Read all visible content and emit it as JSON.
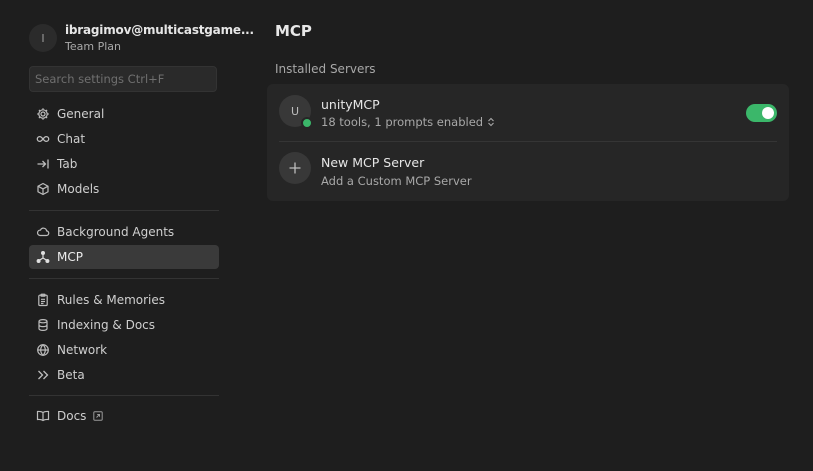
{
  "account": {
    "avatar_initial": "I",
    "email": "ibragimov@multicastgame...",
    "plan": "Team Plan"
  },
  "search": {
    "placeholder": "Search settings Ctrl+F"
  },
  "sidebar": {
    "groups": [
      [
        {
          "label": "General",
          "icon": "gear-icon"
        },
        {
          "label": "Chat",
          "icon": "infinity-icon"
        },
        {
          "label": "Tab",
          "icon": "arrow-right-bar-icon"
        },
        {
          "label": "Models",
          "icon": "cube-icon"
        }
      ],
      [
        {
          "label": "Background Agents",
          "icon": "cloud-icon"
        },
        {
          "label": "MCP",
          "icon": "mcp-nodes-icon",
          "active": true
        }
      ],
      [
        {
          "label": "Rules & Memories",
          "icon": "clipboard-icon"
        },
        {
          "label": "Indexing & Docs",
          "icon": "database-icon"
        },
        {
          "label": "Network",
          "icon": "globe-icon"
        },
        {
          "label": "Beta",
          "icon": "double-chevron-right-icon"
        }
      ],
      [
        {
          "label": "Docs",
          "icon": "book-icon",
          "external": true
        }
      ]
    ]
  },
  "main": {
    "title": "MCP",
    "section_label": "Installed Servers",
    "servers": [
      {
        "avatar_initial": "U",
        "name": "unityMCP",
        "summary": "18 tools, 1 prompts enabled",
        "enabled": true,
        "status": "connected"
      }
    ],
    "add_server": {
      "title": "New MCP Server",
      "subtitle": "Add a Custom MCP Server",
      "icon": "plus-icon"
    }
  },
  "colors": {
    "background": "#1e1e1e",
    "panel": "#262626",
    "active_item": "#3a3a3a",
    "accent_green": "#3bb76a"
  }
}
